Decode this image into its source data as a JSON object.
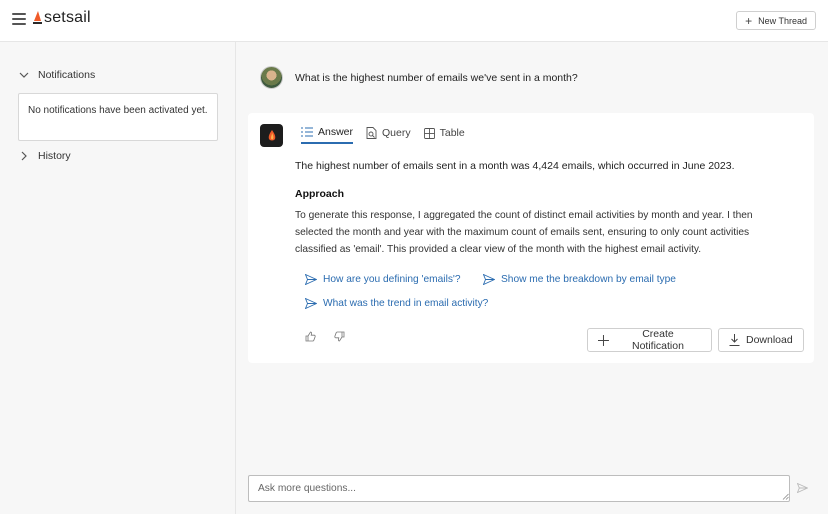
{
  "app": {
    "name": "setsail"
  },
  "header": {
    "new_thread_label": "New Thread"
  },
  "sidebar": {
    "notifications_label": "Notifications",
    "notifications_empty": "No notifications have been activated yet.",
    "history_label": "History"
  },
  "thread": {
    "question": "What is the highest number of emails we've sent in a month?",
    "tabs": [
      {
        "label": "Answer",
        "active": true
      },
      {
        "label": "Query",
        "active": false
      },
      {
        "label": "Table",
        "active": false
      }
    ],
    "summary": "The highest number of emails sent in a month was 4,424 emails, which occurred in June 2023.",
    "approach_title": "Approach",
    "approach_text": "To generate this response, I aggregated the count of distinct email activities by month and year. I then selected the month and year with the maximum count of emails sent, ensuring to only count activities classified as 'email'. This provided a clear view of the month with the highest email activity.",
    "suggestions": [
      "How are you defining 'emails'?",
      "Show me the breakdown by email type",
      "What was the trend in email activity?"
    ],
    "create_notification_label": "Create Notification",
    "download_label": "Download"
  },
  "composer": {
    "placeholder": "Ask more questions..."
  },
  "colors": {
    "accent": "#2b6cb0",
    "logo_orange": "#f05a28"
  }
}
